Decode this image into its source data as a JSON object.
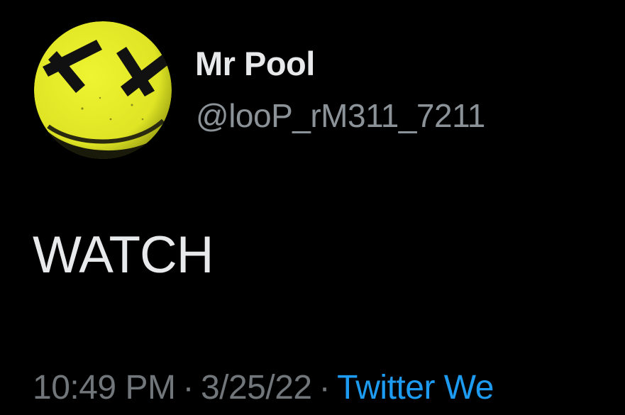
{
  "tweet": {
    "author": {
      "display_name": "Mr Pool",
      "handle": "@looP_rM311_7211",
      "avatar": {
        "icon": "yellow-smiley-taped-eyes-avatar",
        "face_color": "#e7ee2a",
        "tape_color": "#111111"
      }
    },
    "text": "WATCH",
    "meta": {
      "time": "10:49 PM",
      "separator": "·",
      "date": "3/25/22",
      "source": "Twitter We"
    }
  },
  "colors": {
    "background": "#000000",
    "primary_text": "#e7e9ea",
    "secondary_text": "#71767b",
    "link": "#1d9bf0"
  }
}
